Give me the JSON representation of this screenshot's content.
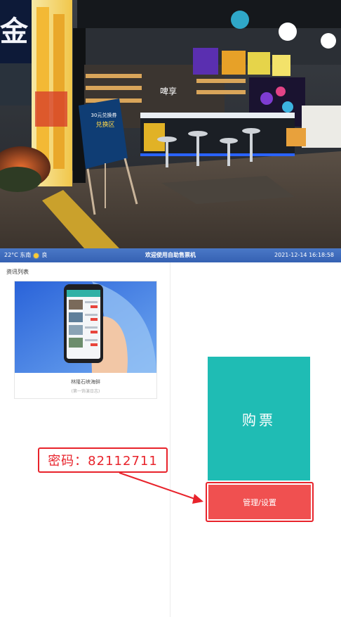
{
  "banner": {
    "photo_sign_text": "金",
    "kiosk_sign_lines": [
      "30元兑换券",
      "兑换区"
    ],
    "bar_sign_text": "啤享"
  },
  "statusbar": {
    "weather": "22°C 东南",
    "weather_extra": "良",
    "title": "欢迎使用自助售票机",
    "datetime": "2021-12-14 16:18:58"
  },
  "news": {
    "section_title": "资讯列表",
    "items": [
      {
        "title": "林隆石峡海鲜",
        "subtitle": "(第一饰演日志)"
      }
    ]
  },
  "actions": {
    "buy_label": "购票",
    "manage_label": "管理/设置"
  },
  "annotation": {
    "password_text": "密码：82112711"
  },
  "colors": {
    "statusbar": "#3f6fc0",
    "buy_button": "#1fbcb4",
    "manage_button": "#f05050",
    "annotation": "#e8232b"
  }
}
